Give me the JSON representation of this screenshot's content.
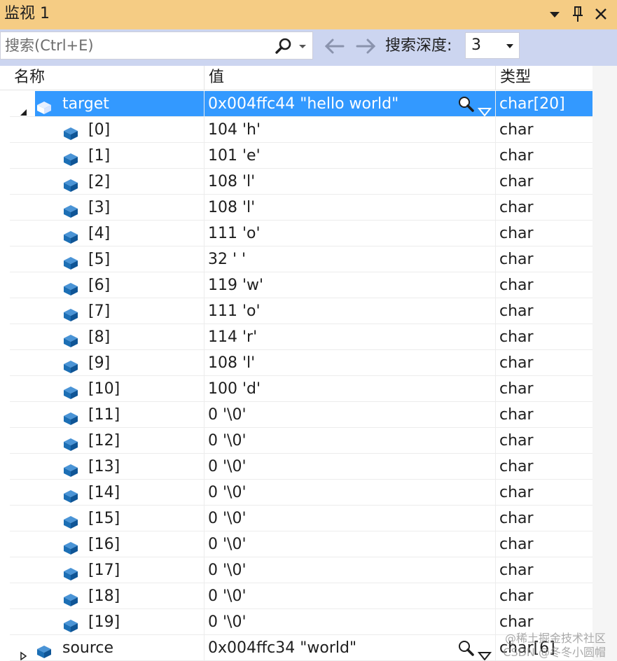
{
  "window": {
    "title": "监视 1",
    "icons": [
      "dropdown-arrow-icon",
      "pin-icon",
      "close-icon"
    ]
  },
  "search": {
    "placeholder": "搜索(Ctrl+E)",
    "depth_label": "搜索深度:",
    "depth_value": "3"
  },
  "columns": {
    "name": "名称",
    "value": "值",
    "type": "类型"
  },
  "rows": [
    {
      "name": "target",
      "value": "0x004ffc44 \"hello world\"",
      "type": "char[20]",
      "level": 0,
      "expander": "expanded",
      "selected": true,
      "visualizer": true
    },
    {
      "name": "[0]",
      "value": "104 'h'",
      "type": "char",
      "level": 1
    },
    {
      "name": "[1]",
      "value": "101 'e'",
      "type": "char",
      "level": 1
    },
    {
      "name": "[2]",
      "value": "108 'l'",
      "type": "char",
      "level": 1
    },
    {
      "name": "[3]",
      "value": "108 'l'",
      "type": "char",
      "level": 1
    },
    {
      "name": "[4]",
      "value": "111 'o'",
      "type": "char",
      "level": 1
    },
    {
      "name": "[5]",
      "value": "32 ' '",
      "type": "char",
      "level": 1
    },
    {
      "name": "[6]",
      "value": "119 'w'",
      "type": "char",
      "level": 1
    },
    {
      "name": "[7]",
      "value": "111 'o'",
      "type": "char",
      "level": 1
    },
    {
      "name": "[8]",
      "value": "114 'r'",
      "type": "char",
      "level": 1
    },
    {
      "name": "[9]",
      "value": "108 'l'",
      "type": "char",
      "level": 1
    },
    {
      "name": "[10]",
      "value": "100 'd'",
      "type": "char",
      "level": 1
    },
    {
      "name": "[11]",
      "value": "0 '\\0'",
      "type": "char",
      "level": 1
    },
    {
      "name": "[12]",
      "value": "0 '\\0'",
      "type": "char",
      "level": 1
    },
    {
      "name": "[13]",
      "value": "0 '\\0'",
      "type": "char",
      "level": 1
    },
    {
      "name": "[14]",
      "value": "0 '\\0'",
      "type": "char",
      "level": 1
    },
    {
      "name": "[15]",
      "value": "0 '\\0'",
      "type": "char",
      "level": 1
    },
    {
      "name": "[16]",
      "value": "0 '\\0'",
      "type": "char",
      "level": 1
    },
    {
      "name": "[17]",
      "value": "0 '\\0'",
      "type": "char",
      "level": 1
    },
    {
      "name": "[18]",
      "value": "0 '\\0'",
      "type": "char",
      "level": 1
    },
    {
      "name": "[19]",
      "value": "0 '\\0'",
      "type": "char",
      "level": 1
    },
    {
      "name": "source",
      "value": "0x004ffc34 \"world\"",
      "type": "char[6]",
      "level": 0,
      "expander": "collapsed",
      "visualizer": true
    }
  ],
  "watermark": {
    "line1": "@稀土掘金技术社区",
    "line2": "CSDN @冬冬小圆帽"
  },
  "colors": {
    "title_bar": "#f5cc84",
    "toolbar": "#ccd5f0",
    "selection": "#3399ff",
    "icon_blue": "#1c6fb5"
  }
}
